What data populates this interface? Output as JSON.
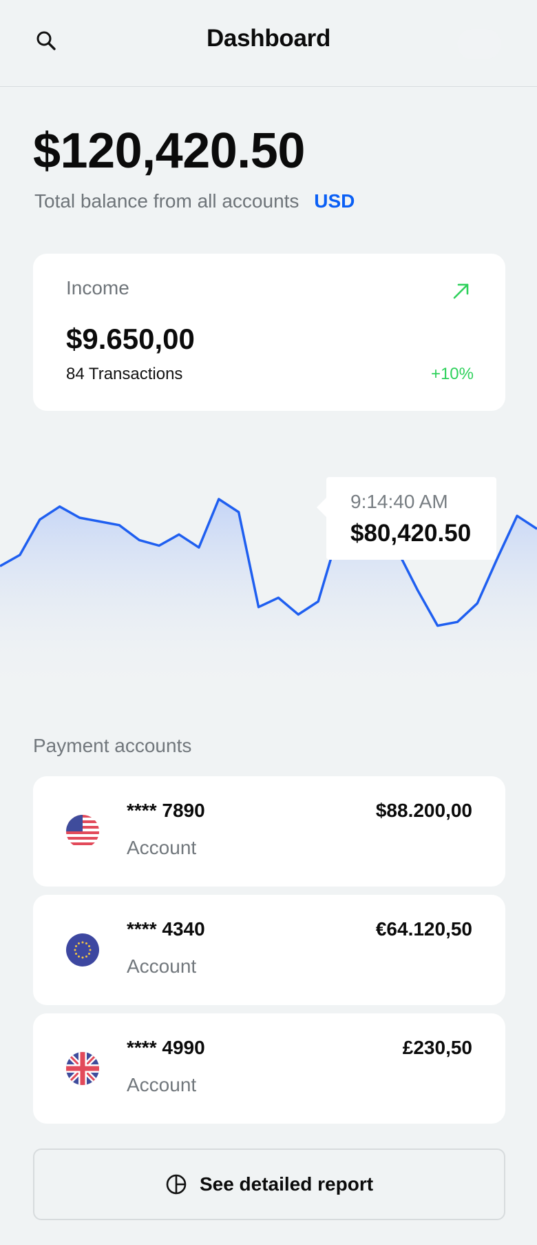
{
  "header": {
    "title": "Dashboard",
    "search_icon": "search-icon"
  },
  "balance": {
    "amount": "$120,420.50",
    "caption": "Total balance from all accounts",
    "currency": "USD"
  },
  "income": {
    "label": "Income",
    "amount": "$9.650,00",
    "transactions": "84 Transactions",
    "change": "+10%",
    "trend_icon": "arrow-up-right-icon",
    "trend_color": "#2ed15b"
  },
  "chart_data": {
    "type": "area",
    "line_color": "#1f5ff0",
    "fill_color": "#c9d8f6",
    "values": [
      44,
      50,
      69,
      76,
      70,
      68,
      66,
      58,
      55,
      61,
      54,
      80,
      73,
      22,
      27,
      18,
      25,
      61,
      77,
      79,
      52,
      31,
      12,
      14,
      24,
      48,
      71,
      64
    ],
    "tooltip": {
      "time": "9:14:40 AM",
      "value": "$80,420.50",
      "point_index": 17
    }
  },
  "accounts": {
    "section_label": "Payment accounts",
    "items": [
      {
        "number": "**** 7890",
        "type": "Account",
        "amount": "$88.200,00",
        "flag": "us-flag-icon"
      },
      {
        "number": "**** 4340",
        "type": "Account",
        "amount": "€64.120,50",
        "flag": "eu-flag-icon"
      },
      {
        "number": "**** 4990",
        "type": "Account",
        "amount": "£230,50",
        "flag": "uk-flag-icon"
      }
    ]
  },
  "report": {
    "label": "See detailed report",
    "icon": "pie-chart-icon"
  },
  "colors": {
    "background": "#f0f3f4",
    "accent": "#0a5ff5",
    "positive": "#2ed15b"
  }
}
